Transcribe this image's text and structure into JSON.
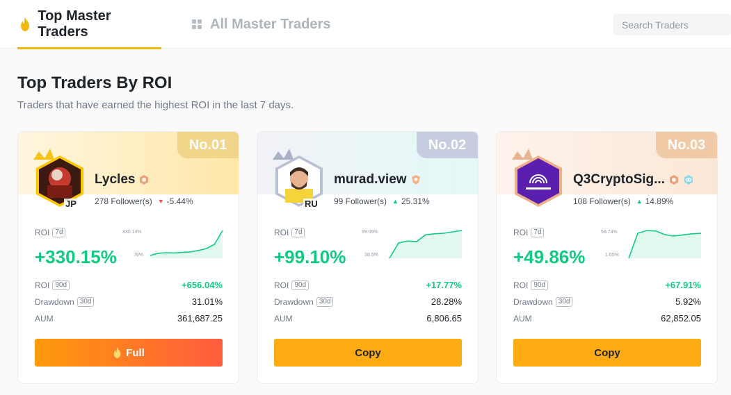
{
  "tabs": [
    {
      "label": "Top Master Traders",
      "icon": "flame-icon",
      "active": true
    },
    {
      "label": "All Master Traders",
      "icon": "grid-icon",
      "active": false
    }
  ],
  "search": {
    "placeholder": "Search Traders"
  },
  "section": {
    "title": "Top Traders By ROI",
    "subtitle": "Traders that have earned the highest ROI in the last 7 days."
  },
  "labels": {
    "roi": "ROI",
    "drawdown": "Drawdown",
    "aum": "AUM",
    "tag_7d": "7d",
    "tag_90d": "90d",
    "tag_30d": "30d"
  },
  "traders": [
    {
      "rank": "No.01",
      "name": "Lycles",
      "country": "JP",
      "followers": "278 Follower(s)",
      "trend": "-5.44%",
      "trend_dir": "down",
      "roi_7d": "+330.15%",
      "spark_max": "330.14%",
      "spark_min": "78%",
      "spark": [
        0.1,
        0.18,
        0.2,
        0.19,
        0.21,
        0.23,
        0.28,
        0.35,
        0.5,
        1.0
      ],
      "roi_90d": "+656.04%",
      "drawdown": "31.01%",
      "aum": "361,687.25",
      "button": "Full",
      "button_type": "full"
    },
    {
      "rank": "No.02",
      "name": "murad.view",
      "country": "RU",
      "followers": "99 Follower(s)",
      "trend": "25.31%",
      "trend_dir": "up",
      "roi_7d": "+99.10%",
      "spark_max": "99.09%",
      "spark_min": "38.5%",
      "spark": [
        0.0,
        0.55,
        0.62,
        0.6,
        0.85,
        0.88,
        0.9,
        0.95,
        1.0
      ],
      "roi_90d": "+17.77%",
      "drawdown": "28.28%",
      "aum": "6,806.65",
      "button": "Copy",
      "button_type": "copy"
    },
    {
      "rank": "No.03",
      "name": "Q3CryptoSig...",
      "country": "",
      "followers": "108 Follower(s)",
      "trend": "14.89%",
      "trend_dir": "up",
      "roi_7d": "+49.86%",
      "spark_max": "58.74%",
      "spark_min": "1.65%",
      "spark": [
        0.0,
        0.9,
        1.0,
        0.98,
        0.85,
        0.8,
        0.84,
        0.88,
        0.9
      ],
      "roi_90d": "+67.91%",
      "drawdown": "5.92%",
      "aum": "62,852.05",
      "button": "Copy",
      "button_type": "copy"
    }
  ],
  "colors": {
    "accent": "#f0b90b",
    "green": "#0ecb81",
    "red": "#f6465d",
    "copy": "#fcac12"
  }
}
